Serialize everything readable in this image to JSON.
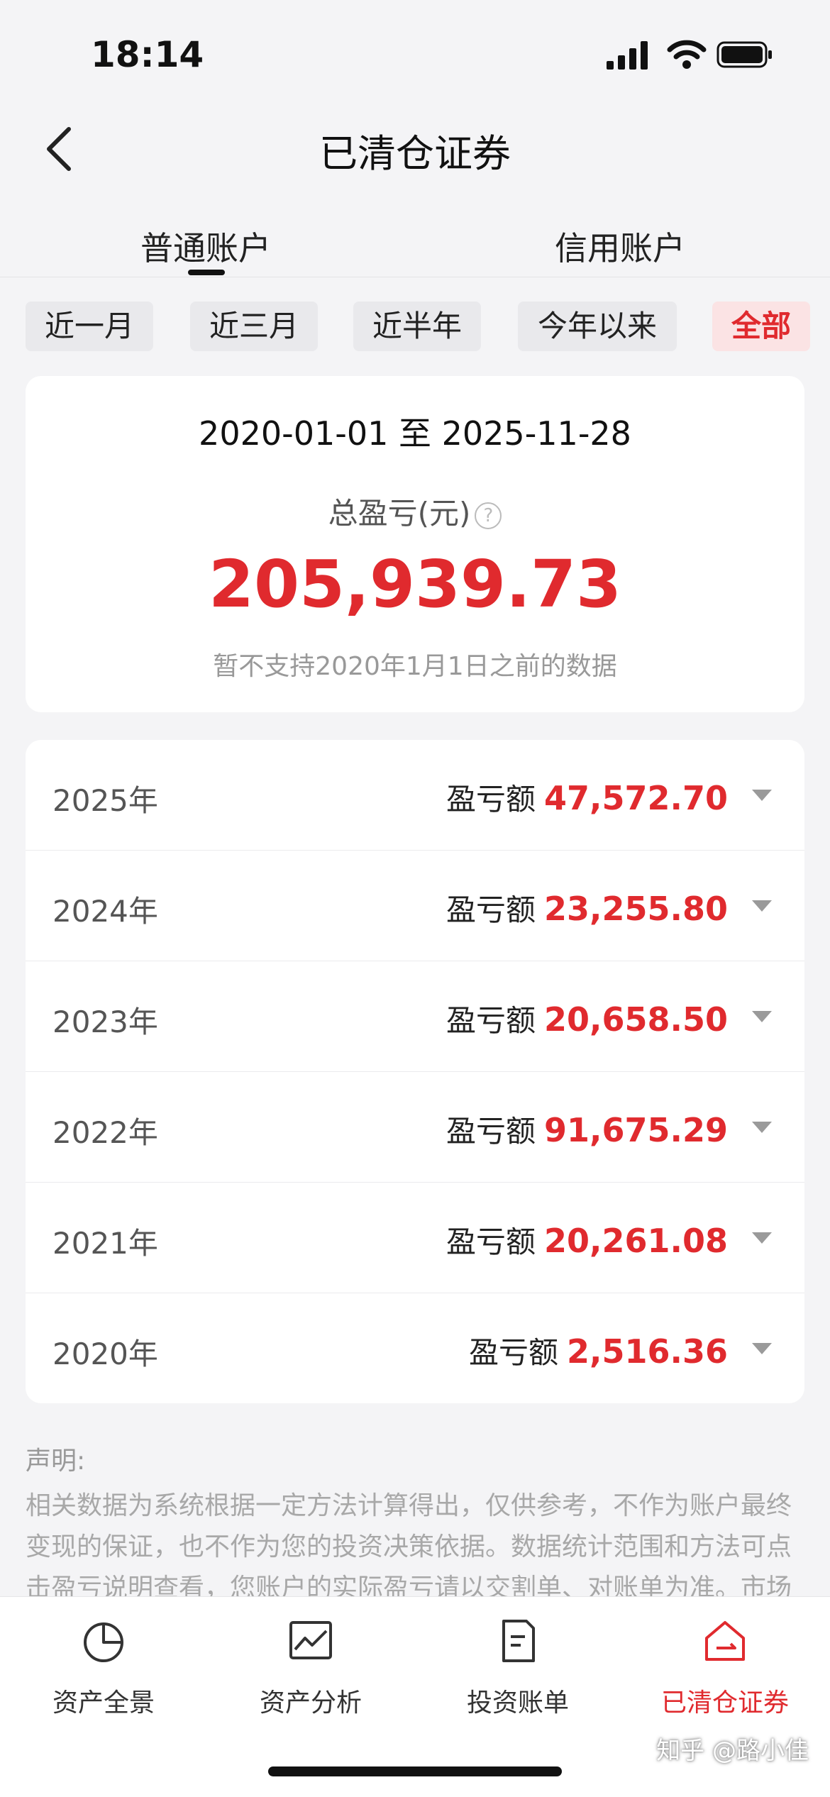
{
  "status_bar": {
    "time": "18:14"
  },
  "header": {
    "title": "已清仓证券"
  },
  "account_tabs": [
    {
      "label": "普通账户",
      "active": true
    },
    {
      "label": "信用账户",
      "active": false
    }
  ],
  "filters": [
    {
      "label": "近一月"
    },
    {
      "label": "近三月"
    },
    {
      "label": "近半年"
    },
    {
      "label": "今年以来"
    },
    {
      "label": "全部",
      "active": true
    }
  ],
  "summary": {
    "range": "2020-01-01 至 2025-11-28",
    "total_label": "总盈亏(元)",
    "total_value": "205,939.73",
    "note": "暂不支持2020年1月1日之前的数据"
  },
  "years": [
    {
      "year": "2025年",
      "label": "盈亏额",
      "value": "47,572.70"
    },
    {
      "year": "2024年",
      "label": "盈亏额",
      "value": "23,255.80"
    },
    {
      "year": "2023年",
      "label": "盈亏额",
      "value": "20,658.50"
    },
    {
      "year": "2022年",
      "label": "盈亏额",
      "value": "91,675.29"
    },
    {
      "year": "2021年",
      "label": "盈亏额",
      "value": "20,261.08"
    },
    {
      "year": "2020年",
      "label": "盈亏额",
      "value": "2,516.36"
    }
  ],
  "disclaimer": {
    "title": "声明:",
    "text": "相关数据为系统根据一定方法计算得出，仅供参考，不作为账户最终变现的保证，也不作为您的投资决策依据。数据统计范围和方法可点击盈亏说明查看，您账户的实际盈亏请以交割单、对账单为准。市场有风"
  },
  "nav": [
    {
      "label": "资产全景",
      "icon": "pie-chart-icon"
    },
    {
      "label": "资产分析",
      "icon": "line-chart-icon"
    },
    {
      "label": "投资账单",
      "icon": "bill-icon"
    },
    {
      "label": "已清仓证券",
      "icon": "cleared-home-icon",
      "active": true
    }
  ],
  "watermark": "知乎 @路小佳",
  "colors": {
    "accent": "#e02a2e",
    "background": "#f4f4f6"
  }
}
